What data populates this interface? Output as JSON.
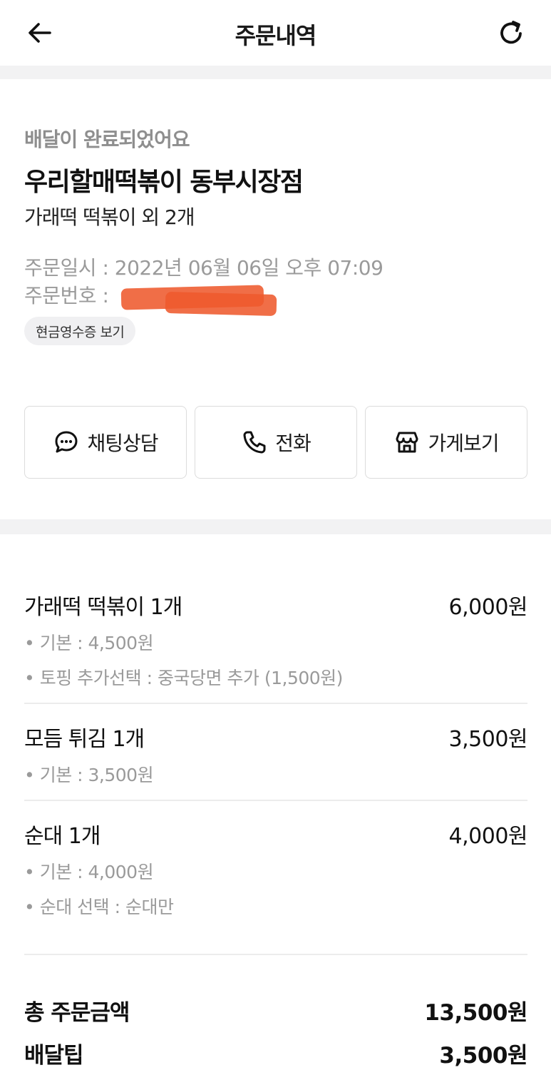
{
  "header": {
    "title": "주문내역",
    "back_icon": "arrow-left-icon",
    "refresh_icon": "refresh-icon"
  },
  "order": {
    "status": "배달이 완료되었어요",
    "store_name": "우리할매떡볶이 동부시장점",
    "summary": "가래떡 떡볶이 외 2개",
    "order_date_label": "주문일시 : 2022년 06월 06일 오후 07:09",
    "order_number_label": "주문번호 :",
    "receipt_button": "현금영수증 보기"
  },
  "actions": [
    {
      "label": "채팅상담",
      "icon": "chat-bubble-icon"
    },
    {
      "label": "전화",
      "icon": "phone-icon"
    },
    {
      "label": "가게보기",
      "icon": "store-icon"
    }
  ],
  "items": [
    {
      "name": "가래떡 떡볶이 1개",
      "price": "6,000원",
      "options": [
        "• 기본 : 4,500원",
        "• 토핑 추가선택 : 중국당면 추가 (1,500원)"
      ]
    },
    {
      "name": "모듬 튀김 1개",
      "price": "3,500원",
      "options": [
        "• 기본 : 3,500원"
      ]
    },
    {
      "name": "순대 1개",
      "price": "4,000원",
      "options": [
        "• 기본 : 4,000원",
        "• 순대 선택 : 순대만"
      ]
    }
  ],
  "totals": {
    "order_total_label": "총 주문금액",
    "order_total_value": "13,500원",
    "delivery_tip_label": "배달팁",
    "delivery_tip_value": "3,500원"
  },
  "colors": {
    "redaction": "#ee5a2e",
    "band": "#f2f2f3",
    "muted": "#9a9a9a"
  }
}
